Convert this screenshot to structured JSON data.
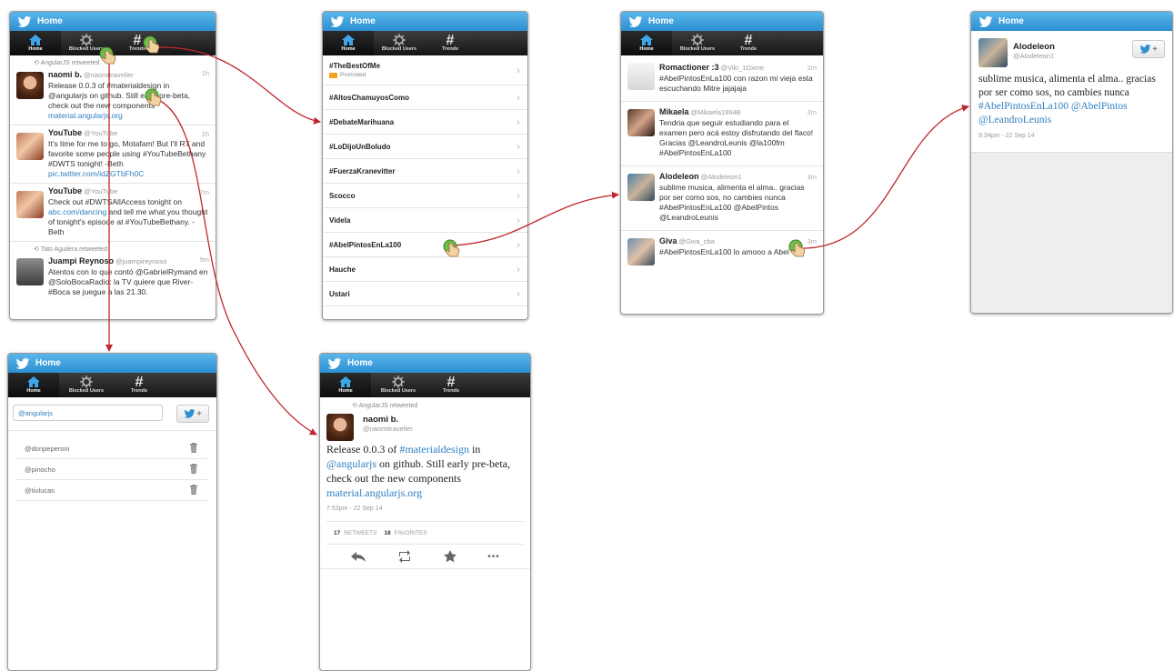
{
  "app": {
    "title": "Home",
    "tabs": [
      "Home",
      "Blocked Users",
      "Trends"
    ]
  },
  "timeline": [
    {
      "rt": "AngularJS retweeted",
      "name": "naomi b.",
      "handle": "@naomitraveller",
      "time": "1h",
      "text": "Release 0.0.3 of #materialdesign in @angularjs on github. Still early pre-beta, check out the new components",
      "link": "material.angularjs.org"
    },
    {
      "rt": "",
      "name": "YouTube",
      "handle": "@YouTube",
      "time": "1h",
      "text": "It's time for me to go, Motafam! But I'll RT and favorite some people using #YouTubeBethany #DWTS tonight! -Beth",
      "link": "pic.twitter.com/idZGTbFh0C"
    },
    {
      "rt": "",
      "name": "YouTube",
      "handle": "@YouTube",
      "time": "7m",
      "text_pre": "Check out #DWTSAllAccess tonight on",
      "link": "abc.com/dancing",
      "text_post": "and tell me what you thought of tonight's episode at #YouTubeBethany. -Beth"
    },
    {
      "rt": "Tato Aguilera retweeted",
      "name": "Juampi Reynoso",
      "handle": "@juampireynoso",
      "time": "9m",
      "text": "Atentos con lo que contó @GabrielRymand en @SoloBocaRadio: la TV quiere que River-#Boca se juegue a las 21.30."
    }
  ],
  "trends": [
    {
      "label": "#TheBestOfMe",
      "promoted": "Promoted"
    },
    {
      "label": "#AltosChamuyosComo"
    },
    {
      "label": "#DebateMarihuana"
    },
    {
      "label": "#LoDijoUnBoludo"
    },
    {
      "label": "#FuerzaKranevitter"
    },
    {
      "label": "Scocco"
    },
    {
      "label": "Videla"
    },
    {
      "label": "#AbelPintosEnLa100"
    },
    {
      "label": "Hauche"
    },
    {
      "label": "Ustari"
    }
  ],
  "search_results": [
    {
      "name": "Romactioner :3",
      "handle": "@Viki_1Dxme",
      "time": "2m",
      "text": "#AbelPintosEnLa100 con razon mi vieja esta escuchando Mitre jajajaja"
    },
    {
      "name": "Mikaela",
      "handle": "@Mikaela1994B",
      "time": "2m",
      "text": "Tendria que seguir estudiando para el examen pero acá estoy disfrutando del flaco! Gracias @LeandroLeunis @la100fm #AbelPintosEnLa100"
    },
    {
      "name": "Alodeleon",
      "handle": "@Alodeleon1",
      "time": "3m",
      "text": "sublime musica, alimenta el alma.. gracias por ser como sos, no cambies nunca #AbelPintosEnLa100 @AbelPintos @LeandroLeunis"
    },
    {
      "name": "Giva",
      "handle": "@Giva_cba",
      "time": "3m",
      "text": "#AbelPintosEnLa100 lo amooo a Abel"
    }
  ],
  "tweet_detail_1": {
    "name": "Alodeleon",
    "handle": "@Alodeleon1",
    "text": "sublime musica, alimenta el alma.. gracias por ser como sos, no cambies nunca",
    "links": "#AbelPintosEnLa100 @AbelPintos @LeandroLeunis",
    "timestamp": "9:34pm - 22 Sep 14",
    "follow_label": "+"
  },
  "blocked": {
    "input_value": "@angularjs",
    "follow_label": "+",
    "users": [
      "@donpeperoni",
      "@pinocho",
      "@tiolucas"
    ]
  },
  "tweet_detail_2": {
    "rt": "AngularJS retweeted",
    "name": "naomi b.",
    "handle": "@naomitraveller",
    "text_a": "Release 0.0.3 of",
    "tag": "#materialdesign",
    "text_b": "in",
    "mention": "@angularjs",
    "text_c": "on github. Still early pre-beta, check out the new components",
    "link": "material.angularjs.org",
    "timestamp": "7:53pm - 22 Sep 14",
    "retweets_count": "17",
    "retweets_label": "RETWEETS",
    "favorites_count": "18",
    "favorites_label": "FAVORITES",
    "more_label": "•••"
  },
  "colors": {
    "titlebar": "#2c8fd2",
    "tabbar": "#151515",
    "link": "#2f7fc0",
    "flow_arrow": "#c0272d"
  }
}
